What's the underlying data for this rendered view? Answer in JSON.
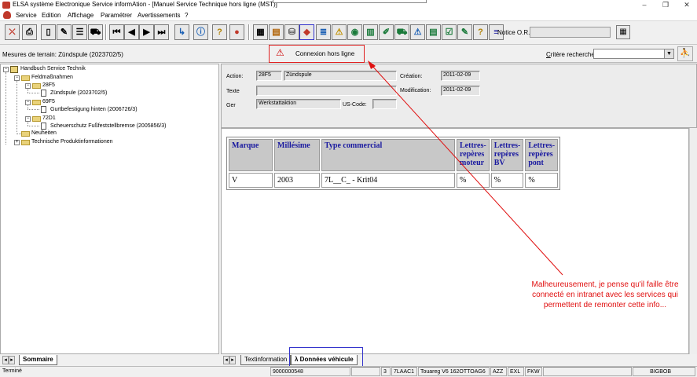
{
  "window": {
    "title": "ELSA système Electronique Service informAtion - [Manuel Service Technique hors ligne (MST)]",
    "controls": [
      "–",
      "❐",
      "✕"
    ]
  },
  "menu": [
    "Service",
    "Edition",
    "Affichage",
    "Paramétrer",
    "Avertissements",
    "?"
  ],
  "toolbar": {
    "notice_label": "Notice O.R.:",
    "notice_value": ""
  },
  "subheader": {
    "mesures": "Mesures de terrain: Zündspule (2023702/5)",
    "offline_label": "Connexion hors ligne",
    "critere_label": "Critère recherche",
    "critere_value": ""
  },
  "tree": {
    "root": "Handbuch Service Technik",
    "feld": "Feldmaßnahmen",
    "n28f5": "28F5",
    "zund": "Zündspule (2023702/5)",
    "n69f5": "69F5",
    "gurt": "Gurtbefestigung hinten (2006726/3)",
    "n72d1": "72D1",
    "scheuer": "Scheuerschutz Fußfeststellbremse (2005856/3)",
    "neu": "Neuheiten",
    "tpi": "Technische Produktinformationen"
  },
  "details": {
    "action_label": "Action:",
    "action_code": "28F5",
    "action_name": "Zündspule",
    "creation_label": "Création:",
    "creation_value": "2011-02-09",
    "texte_label": "Texte",
    "texte_value": "",
    "modification_label": "Modification:",
    "modification_value": "2011-02-09",
    "ger_label": "Ger",
    "ger_value": "Werkstattaktion",
    "uscode_label": "US-Code:",
    "uscode_value": ""
  },
  "vehicle_table": {
    "headers": [
      "Marque",
      "Millésime",
      "Type commercial",
      "Lettres-repères moteur",
      "Lettres-repères BV",
      "Lettres-repères pont"
    ],
    "header_lines": [
      [
        "Marque"
      ],
      [
        "Millésime"
      ],
      [
        "Type commercial"
      ],
      [
        "Lettres-",
        "repères",
        "moteur"
      ],
      [
        "Lettres-",
        "repères",
        "BV"
      ],
      [
        "Lettres-",
        "repères",
        "pont"
      ]
    ],
    "rows": [
      [
        "V",
        "2003",
        "7L__C_ - Krit04",
        "%",
        "%",
        "%"
      ]
    ]
  },
  "annotation": "Malheureusement, je pense qu'il faille être connecté en intranet avec les services qui permettent de remonter cette info...",
  "left_tabs": [
    "Sommaire"
  ],
  "right_tabs": [
    "Textinformation",
    "λ Données véhicule"
  ],
  "statusbar": {
    "left": "Terminé",
    "cells": [
      "9000000548",
      "",
      "3",
      "7LAAC1",
      "Touareg V6 162OTTOAG6",
      "AZZ",
      "EXL",
      "FKW",
      "",
      "BIGBOB"
    ]
  },
  "colors": {
    "annotation_red": "#e01010",
    "highlight_blue": "#3333cc",
    "table_header_text": "#1a1aa0"
  }
}
